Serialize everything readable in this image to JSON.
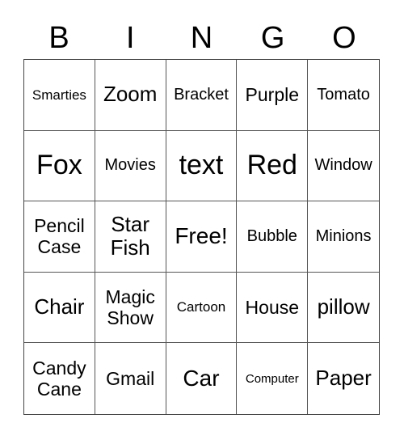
{
  "header": {
    "letters": [
      "B",
      "I",
      "N",
      "G",
      "O"
    ]
  },
  "cells": [
    "Smarties",
    "Zoom",
    "Bracket",
    "Purple",
    "Tomato",
    "Fox",
    "Movies",
    "text",
    "Red",
    "Window",
    "Pencil Case",
    "Star Fish",
    "Free!",
    "Bubble",
    "Minions",
    "Chair",
    "Magic Show",
    "Cartoon",
    "House",
    "pillow",
    "Candy Cane",
    "Gmail",
    "Car",
    "Computer",
    "Paper"
  ]
}
